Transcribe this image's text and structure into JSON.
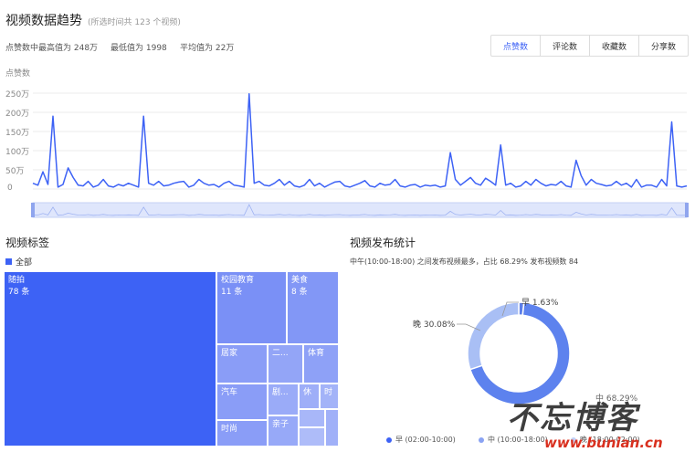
{
  "trend": {
    "title": "视频数据趋势",
    "subtitle": "(所选时间共 123 个视频)",
    "stats": {
      "max": "点赞数中最高值为 248万",
      "min": "最低值为 1998",
      "avg": "平均值为 22万"
    },
    "tabs": [
      "点赞数",
      "评论数",
      "收藏数",
      "分享数"
    ],
    "active_tab": 0,
    "accent": "#3d62f5"
  },
  "chart_data": {
    "type": "line",
    "ylabel": "点赞数",
    "y_ticks": [
      "250万",
      "200万",
      "150万",
      "100万",
      "50万",
      "0"
    ],
    "ylim": [
      0,
      250
    ],
    "unit": "万",
    "values": [
      15,
      10,
      45,
      12,
      190,
      5,
      12,
      55,
      30,
      10,
      8,
      20,
      5,
      10,
      25,
      8,
      5,
      12,
      8,
      15,
      10,
      5,
      190,
      15,
      10,
      20,
      8,
      10,
      15,
      18,
      20,
      5,
      10,
      25,
      15,
      10,
      12,
      5,
      15,
      20,
      10,
      8,
      5,
      248,
      15,
      20,
      10,
      8,
      15,
      25,
      10,
      20,
      8,
      5,
      10,
      25,
      8,
      15,
      5,
      12,
      18,
      20,
      8,
      5,
      10,
      15,
      22,
      8,
      5,
      15,
      10,
      12,
      25,
      8,
      5,
      10,
      12,
      5,
      10,
      8,
      10,
      5,
      8,
      95,
      25,
      10,
      20,
      30,
      15,
      10,
      28,
      20,
      10,
      115,
      10,
      15,
      5,
      8,
      20,
      10,
      25,
      15,
      8,
      12,
      10,
      20,
      8,
      5,
      75,
      35,
      10,
      25,
      15,
      12,
      8,
      10,
      20,
      10,
      15,
      5,
      25,
      5,
      10,
      10,
      5,
      25,
      8,
      175,
      8,
      5,
      8
    ]
  },
  "tags": {
    "title": "视频标签",
    "legend": "全部",
    "items": [
      {
        "label": "随拍",
        "count": "78 条"
      },
      {
        "label": "校园教育",
        "count": "11 条"
      },
      {
        "label": "美食",
        "count": "8 条"
      },
      {
        "label": "居家",
        "count": ""
      },
      {
        "label": "二...",
        "count": ""
      },
      {
        "label": "体育",
        "count": ""
      },
      {
        "label": "汽车",
        "count": ""
      },
      {
        "label": "剧...",
        "count": ""
      },
      {
        "label": "休",
        "count": ""
      },
      {
        "label": "时",
        "count": ""
      },
      {
        "label": "时尚",
        "count": ""
      },
      {
        "label": "亲子",
        "count": ""
      }
    ]
  },
  "publish": {
    "title": "视频发布统计",
    "summary": "中午(10:00-18:00) 之间发布视频最多，占比 68.29%  发布视频数 84",
    "slices": [
      {
        "name": "早",
        "pct": 1.63,
        "label": "早 1.63%",
        "color": "#5d7fe9"
      },
      {
        "name": "中",
        "pct": 68.29,
        "label": "中 68.29%",
        "color": "#5d82ee"
      },
      {
        "name": "晚",
        "pct": 30.08,
        "label": "晚 30.08%",
        "color": "#a9bff5"
      }
    ],
    "legend": [
      "早 (02:00-10:00)",
      "中 (10:00-18:00)",
      "晚 (18:00-02:00)"
    ]
  },
  "watermark": {
    "text": "不忘博客",
    "url": "www.bunian.cn"
  }
}
